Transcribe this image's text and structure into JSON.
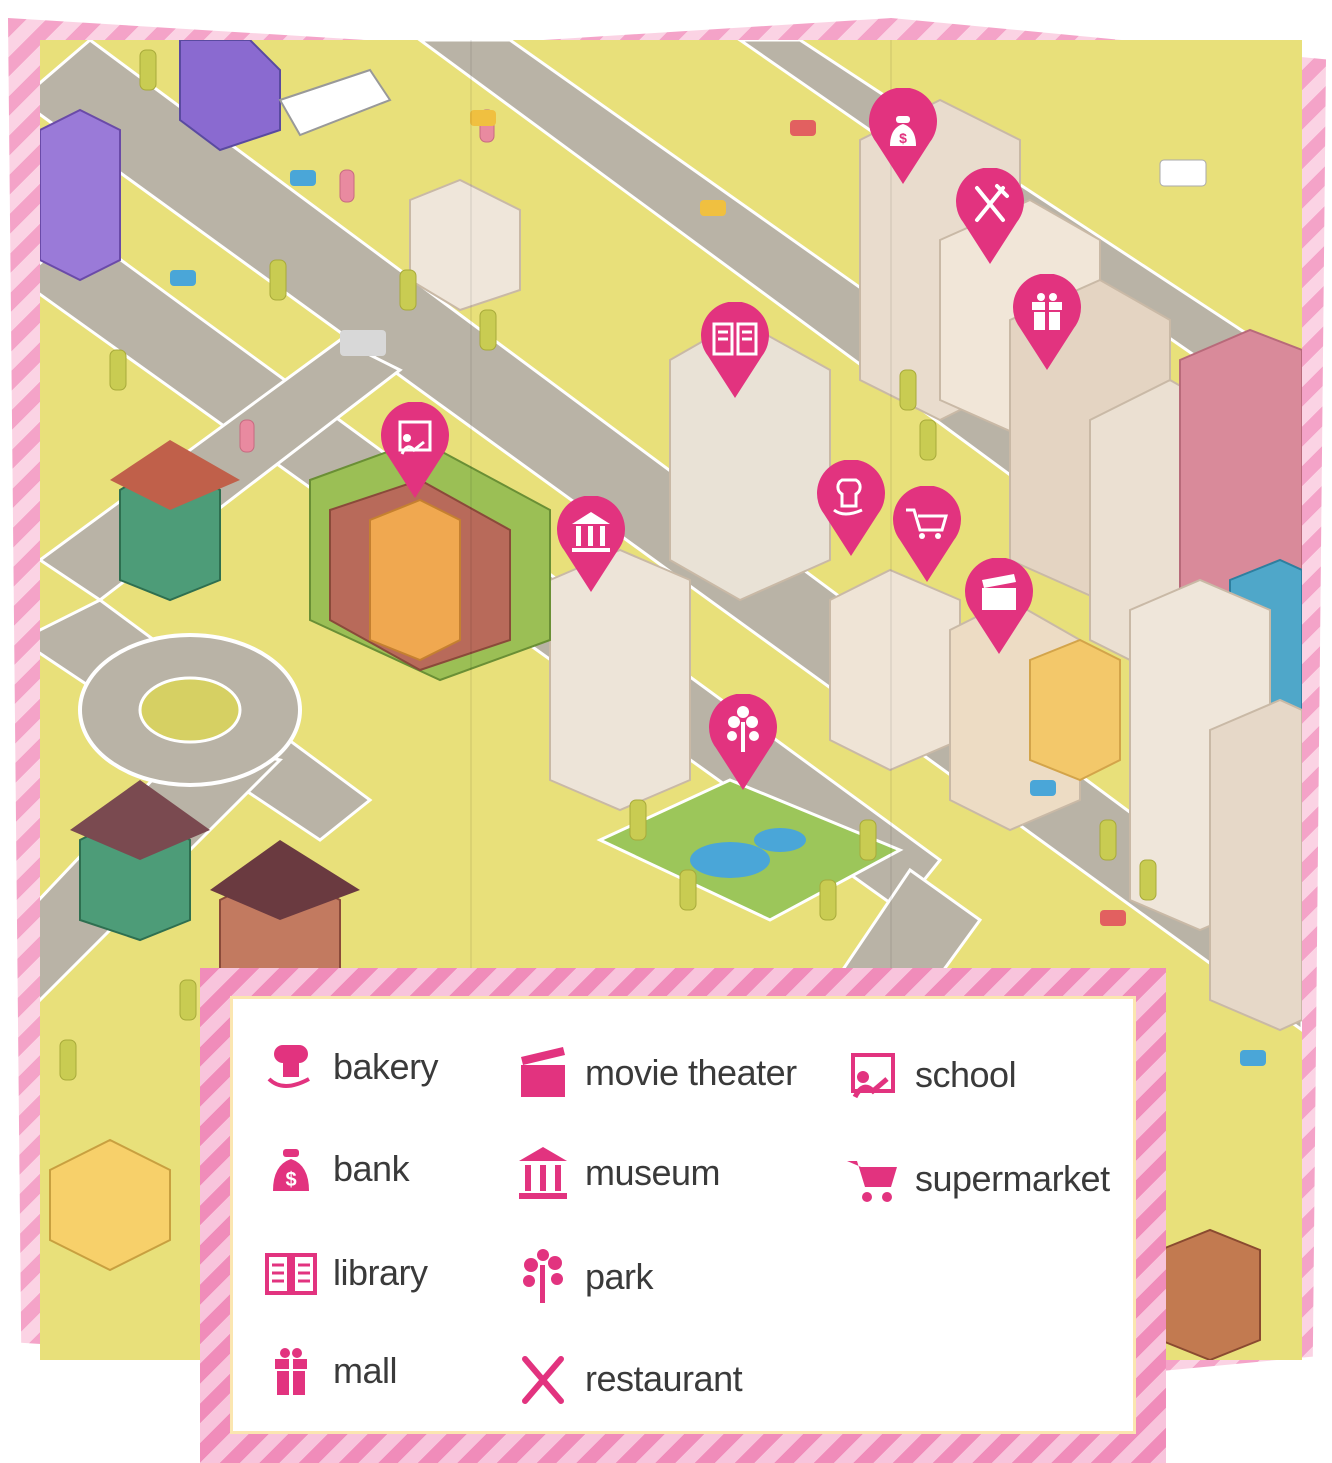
{
  "colors": {
    "accent": "#e2337f",
    "ground": "#e8e07a",
    "road": "#b9b3a6",
    "frame_pink": "#f4a3c8"
  },
  "map": {
    "pins": [
      {
        "id": "bank",
        "icon": "money-bag-icon"
      },
      {
        "id": "restaurant",
        "icon": "fork-knife-icon"
      },
      {
        "id": "mall",
        "icon": "gift-icon"
      },
      {
        "id": "library",
        "icon": "book-icon"
      },
      {
        "id": "school",
        "icon": "teacher-board-icon"
      },
      {
        "id": "museum",
        "icon": "columns-icon"
      },
      {
        "id": "bakery",
        "icon": "bread-icon"
      },
      {
        "id": "supermarket",
        "icon": "cart-icon"
      },
      {
        "id": "movie-theater",
        "icon": "clapperboard-icon"
      },
      {
        "id": "park",
        "icon": "tree-icon"
      }
    ]
  },
  "legend": {
    "items": [
      {
        "label": "bakery",
        "icon": "bread-icon"
      },
      {
        "label": "bank",
        "icon": "money-bag-icon"
      },
      {
        "label": "library",
        "icon": "book-icon"
      },
      {
        "label": "mall",
        "icon": "gift-icon"
      },
      {
        "label": "movie theater",
        "icon": "clapperboard-icon"
      },
      {
        "label": "museum",
        "icon": "columns-icon"
      },
      {
        "label": "park",
        "icon": "tree-icon"
      },
      {
        "label": "restaurant",
        "icon": "fork-knife-icon"
      },
      {
        "label": "school",
        "icon": "teacher-board-icon"
      },
      {
        "label": "supermarket",
        "icon": "cart-icon"
      }
    ]
  }
}
